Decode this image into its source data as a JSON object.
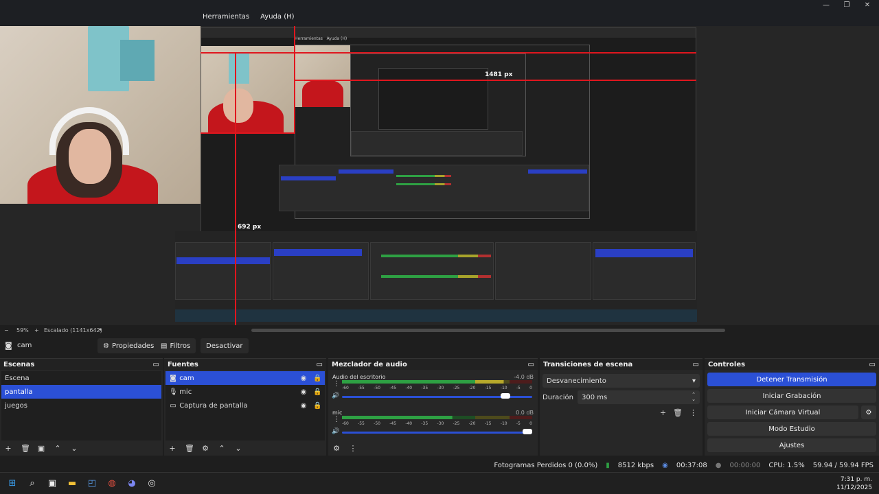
{
  "menu": {
    "items": [
      "Herramientas",
      "Ayuda (H)"
    ]
  },
  "window": {
    "minimize": "—",
    "maximize": "❐",
    "close": "✕"
  },
  "preview": {
    "measure_h": "1481 px",
    "measure_v": "692 px",
    "inner_menu": [
      "Herramientas",
      "Ayuda (H)"
    ]
  },
  "scalebar": {
    "zoom_minus": "−",
    "zoom": "59%",
    "zoom_plus": "+",
    "scaled": "Escalado (1141x642)"
  },
  "source_toolbar": {
    "source_name": "cam",
    "properties": "Propiedades",
    "filters": "Filtros",
    "deactivate": "Desactivar"
  },
  "scenes": {
    "title": "Escenas",
    "items": [
      {
        "label": "Escena",
        "selected": false
      },
      {
        "label": "pantalla",
        "selected": true
      },
      {
        "label": "juegos",
        "selected": false
      }
    ]
  },
  "sources": {
    "title": "Fuentes",
    "items": [
      {
        "label": "cam",
        "icon": "camera-icon",
        "selected": true
      },
      {
        "label": "mic",
        "icon": "microphone-icon",
        "selected": false
      },
      {
        "label": "Captura de pantalla",
        "icon": "monitor-icon",
        "selected": false
      }
    ]
  },
  "mixer": {
    "title": "Mezclador de audio",
    "channels": [
      {
        "name": "Audio del escritorio",
        "db": "-4.0 dB",
        "level": 0.85,
        "volume": 0.88
      },
      {
        "name": "mic",
        "db": "0.0 dB",
        "level": 0.58,
        "volume": 1.0
      }
    ],
    "ticks": [
      "-60",
      "-55",
      "-50",
      "-45",
      "-40",
      "-35",
      "-30",
      "-25",
      "-20",
      "-15",
      "-10",
      "-5",
      "0"
    ]
  },
  "transitions": {
    "title": "Transiciones de escena",
    "selected": "Desvanecimiento",
    "duration_label": "Duración",
    "duration_value": "300 ms"
  },
  "controls": {
    "title": "Controles",
    "stop_stream": "Detener Transmisión",
    "start_recording": "Iniciar Grabación",
    "start_virtual_cam": "Iniciar Cámara Virtual",
    "studio_mode": "Modo Estudio",
    "settings": "Ajustes"
  },
  "status": {
    "dropped_frames": "Fotogramas Perdidos 0 (0.0%)",
    "bitrate": "8512 kbps",
    "stream_time": "00:37:08",
    "rec_time": "00:00:00",
    "cpu": "CPU: 1.5%",
    "fps": "59.94 / 59.94 FPS"
  },
  "clock": {
    "time": "7:31 p. m.",
    "date": "11/12/2025"
  },
  "colors": {
    "accent": "#2b50d6",
    "red": "#e0161e",
    "meter_green": "#2ea043"
  }
}
